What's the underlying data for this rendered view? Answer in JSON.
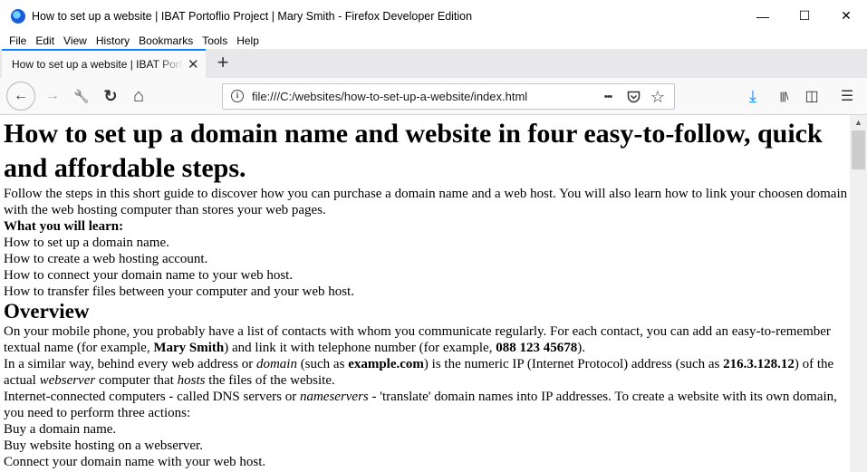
{
  "window": {
    "title": "How to set up a website | IBAT Portoflio Project | Mary Smith - Firefox Developer Edition",
    "minimize": "—",
    "maximize": "☐",
    "close": "✕"
  },
  "menu": [
    "File",
    "Edit",
    "View",
    "History",
    "Bookmarks",
    "Tools",
    "Help"
  ],
  "tab": {
    "label": "How to set up a website | IBAT Portoflio Project | Mary Smith",
    "close": "✕",
    "new": "+"
  },
  "nav": {
    "back": "←",
    "forward": "→",
    "tools": "🔧",
    "reload": "↻",
    "home": "⌂",
    "url_info": "i",
    "url": "file:///C:/websites/how-to-set-up-a-website/index.html",
    "page_actions": "•••",
    "pocket": "◡",
    "bookmark": "☆",
    "download": "⤓",
    "library": "|||\\",
    "sidebar": "◫",
    "hamburger": "☰"
  },
  "page": {
    "h1": "How to set up a domain name and website in four easy-to-follow, quick and affordable steps.",
    "intro": "Follow the steps in this short guide to discover how you can purchase a domain name and a web host. You will also learn how to link your choosen domain with the web hosting computer than stores your web pages.",
    "learn_heading": "What you will learn:",
    "learn_items": [
      "How to set up a domain name.",
      "How to create a web hosting account.",
      "How to connect your domain name to your web host.",
      "How to transfer files between your computer and your web host."
    ],
    "overview_heading": "Overview",
    "p1": {
      "a": "On your mobile phone, you probably have a list of contacts with whom you communicate regularly. For each contact, you can add an easy-to-remember textual name (for example, ",
      "b": "Mary Smith",
      "c": ") and link it with telephone number (for example, ",
      "d": "088 123 45678",
      "e": ")."
    },
    "p2": {
      "a": "In a similar way, behind every web address or ",
      "b": "domain",
      "c": " (such as ",
      "d": "example.com",
      "e": ") is the numeric IP (Internet Protocol) address (such as ",
      "f": "216.3.128.12",
      "g": ") of the actual ",
      "h": "webserver",
      "i": " computer that ",
      "j": "hosts",
      "k": " the files of the website."
    },
    "p3": {
      "a": "Internet-connected computers - called DNS servers or ",
      "b": "nameservers",
      "c": " - 'translate' domain names into IP addresses. To create a website with its own domain, you need to perform three actions:"
    },
    "actions": [
      "Buy a domain name.",
      "Buy website hosting on a webserver.",
      "Connect your domain name with your web host."
    ]
  },
  "scrollbar": {
    "up": "▲"
  }
}
